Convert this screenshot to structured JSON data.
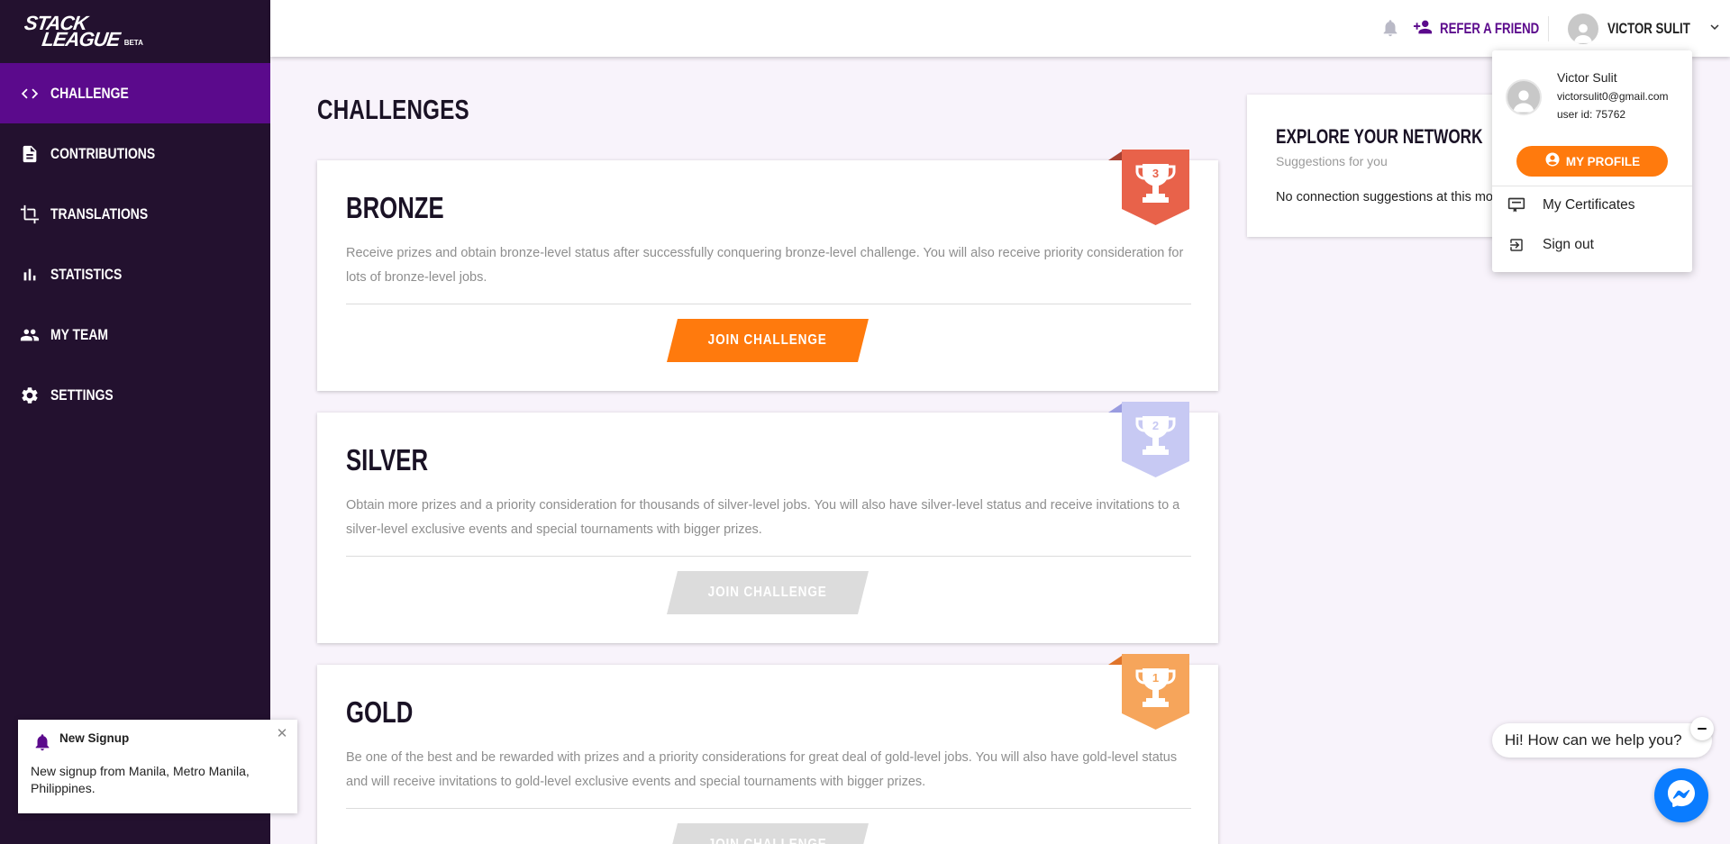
{
  "brand": {
    "logo_line1": "STACK",
    "logo_line2": "LEAGUE",
    "beta": "BETA"
  },
  "sidebar": {
    "items": [
      {
        "label": "Challenge",
        "icon": "code-icon",
        "active": true
      },
      {
        "label": "Contributions",
        "icon": "document-icon",
        "active": false
      },
      {
        "label": "Translations",
        "icon": "crop-icon",
        "active": false
      },
      {
        "label": "Statistics",
        "icon": "bar-chart-icon",
        "active": false
      },
      {
        "label": "My Team",
        "icon": "people-icon",
        "active": false
      },
      {
        "label": "Settings",
        "icon": "gear-icon",
        "active": false
      }
    ]
  },
  "header": {
    "refer_label": "REFER A FRIEND",
    "user_name": "VICTOR SULIT"
  },
  "main": {
    "title": "CHALLENGES",
    "challenges": [
      {
        "title": "BRONZE",
        "rank": "3",
        "description": "Receive prizes and obtain bronze-level status after successfully conquering bronze-level challenge. You will also receive priority consideration for lots of bronze-level jobs.",
        "button": "JOIN CHALLENGE",
        "enabled": true,
        "badge_color": "#e8624a"
      },
      {
        "title": "SILVER",
        "rank": "2",
        "description": "Obtain more prizes and a priority consideration for thousands of silver-level jobs. You will also have silver-level status and receive invitations to a silver-level exclusive events and special tournaments with bigger prizes.",
        "button": "JOIN CHALLENGE",
        "enabled": false,
        "badge_color": "#c7c9f3"
      },
      {
        "title": "GOLD",
        "rank": "1",
        "description": "Be one of the best and be rewarded with prizes and a priority considerations for great deal of gold-level jobs. You will also have gold-level status and will receive invitations to gold-level exclusive events and special tournaments with bigger prizes.",
        "button": "JOIN CHALLENGE",
        "enabled": false,
        "badge_color": "#f6a55b"
      }
    ]
  },
  "explore": {
    "title": "EXPLORE YOUR NETWORK",
    "subtitle": "Suggestions for you",
    "empty": "No connection suggestions at this mo"
  },
  "dropdown": {
    "name": "Victor Sulit",
    "email": "victorsulit0@gmail.com",
    "user_id": "user id: 75762",
    "profile_button": "MY PROFILE",
    "items": [
      {
        "label": "My Certificates",
        "icon": "certificate-icon"
      },
      {
        "label": "Sign out",
        "icon": "sign-out-icon"
      }
    ]
  },
  "toast": {
    "title": "New Signup",
    "body": "New signup from Manila, Metro Manila, Philippines."
  },
  "chat": {
    "greeting": "Hi! How can we help you?"
  },
  "colors": {
    "sidebar_bg": "#23112f",
    "active_nav": "#5b0a8c",
    "accent_orange": "#ff7a0d",
    "disabled_button": "#dcdcdc",
    "messenger_blue": "#0a7cff"
  }
}
